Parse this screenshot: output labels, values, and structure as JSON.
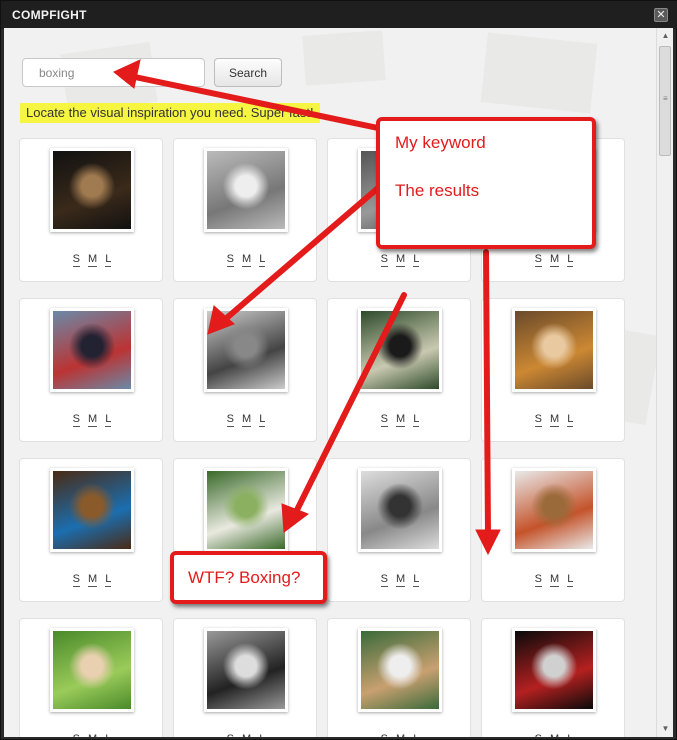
{
  "window": {
    "title": "COMPFIGHT",
    "close_glyph": "✕"
  },
  "search": {
    "value": "boxing",
    "placeholder": "",
    "button_label": "Search"
  },
  "tagline": "Locate the visual inspiration you need. Super fast!",
  "size_options": [
    "S",
    "M",
    "L"
  ],
  "results": [
    {
      "subject": "boxing-ring-knockout"
    },
    {
      "subject": "bw-fist-closeup"
    },
    {
      "subject": "boxing-photo"
    },
    {
      "subject": "boxing-photo"
    },
    {
      "subject": "muay-thai-kick"
    },
    {
      "subject": "bw-man-with-fist"
    },
    {
      "subject": "angry-boxer-face"
    },
    {
      "subject": "kids-boxing-outdoor"
    },
    {
      "subject": "punching-bag-room"
    },
    {
      "subject": "woman-white-dress-water"
    },
    {
      "subject": "bw-man-fist-forward"
    },
    {
      "subject": "woman-boxing-gloves"
    },
    {
      "subject": "woman-lying-in-grass"
    },
    {
      "subject": "bw-street-dancers"
    },
    {
      "subject": "woman-in-woods"
    },
    {
      "subject": "boxer-red-lit-gym"
    }
  ],
  "annotations": {
    "main_callout": {
      "line1": "My keyword",
      "line2": "The results"
    },
    "wtf_callout": "WTF? Boxing?",
    "accent_color": "#e31b1b"
  },
  "colors": {
    "tagline_bg": "#f5f542",
    "titlebar": "#1f1f1f",
    "panel_bg": "#f1f1f1"
  }
}
